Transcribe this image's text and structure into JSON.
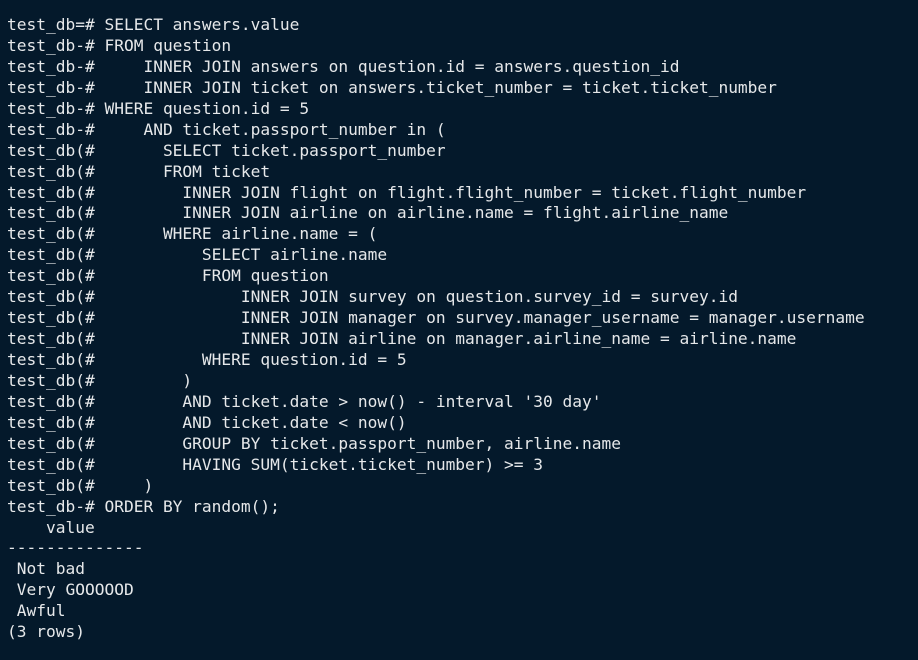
{
  "terminal": {
    "lines": [
      {
        "prompt": "test_db=#",
        "text": " SELECT answers.value"
      },
      {
        "prompt": "test_db-#",
        "text": " FROM question"
      },
      {
        "prompt": "test_db-#",
        "text": "     INNER JOIN answers on question.id = answers.question_id"
      },
      {
        "prompt": "test_db-#",
        "text": "     INNER JOIN ticket on answers.ticket_number = ticket.ticket_number"
      },
      {
        "prompt": "test_db-#",
        "text": " WHERE question.id = 5"
      },
      {
        "prompt": "test_db-#",
        "text": "     AND ticket.passport_number in ("
      },
      {
        "prompt": "test_db(#",
        "text": "       SELECT ticket.passport_number"
      },
      {
        "prompt": "test_db(#",
        "text": "       FROM ticket"
      },
      {
        "prompt": "test_db(#",
        "text": "         INNER JOIN flight on flight.flight_number = ticket.flight_number"
      },
      {
        "prompt": "test_db(#",
        "text": "         INNER JOIN airline on airline.name = flight.airline_name"
      },
      {
        "prompt": "test_db(#",
        "text": "       WHERE airline.name = ("
      },
      {
        "prompt": "test_db(#",
        "text": "           SELECT airline.name"
      },
      {
        "prompt": "test_db(#",
        "text": "           FROM question"
      },
      {
        "prompt": "test_db(#",
        "text": "               INNER JOIN survey on question.survey_id = survey.id"
      },
      {
        "prompt": "test_db(#",
        "text": "               INNER JOIN manager on survey.manager_username = manager.username"
      },
      {
        "prompt": "test_db(#",
        "text": "               INNER JOIN airline on manager.airline_name = airline.name"
      },
      {
        "prompt": "test_db(#",
        "text": "           WHERE question.id = 5"
      },
      {
        "prompt": "test_db(#",
        "text": "         )"
      },
      {
        "prompt": "test_db(#",
        "text": "         AND ticket.date > now() - interval '30 day'"
      },
      {
        "prompt": "test_db(#",
        "text": "         AND ticket.date < now()"
      },
      {
        "prompt": "test_db(#",
        "text": "         GROUP BY ticket.passport_number, airline.name"
      },
      {
        "prompt": "test_db(#",
        "text": "         HAVING SUM(ticket.ticket_number) >= 3"
      },
      {
        "prompt": "test_db(#",
        "text": "     )"
      },
      {
        "prompt": "test_db-#",
        "text": " ORDER BY random();"
      }
    ],
    "result": {
      "header": "    value",
      "separator": "--------------",
      "rows": [
        " Not bad",
        " Very GOOOOOD",
        " Awful"
      ],
      "footer": "(3 rows)"
    }
  }
}
